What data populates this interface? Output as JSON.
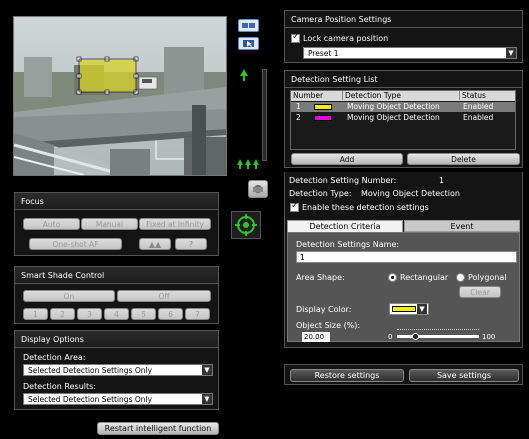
{
  "focus": {
    "title": "Focus",
    "auto": "Auto",
    "manual": "Manual",
    "fixed": "Fixed at Infinity",
    "one_shot": "One-shot AF"
  },
  "smart_shade": {
    "title": "Smart Shade Control",
    "on": "On",
    "off": "Off",
    "levels": [
      "1",
      "2",
      "3",
      "4",
      "5",
      "6",
      "7"
    ]
  },
  "display_options": {
    "title": "Display Options",
    "area_label": "Detection Area:",
    "area_value": "Selected Detection Settings Only",
    "results_label": "Detection Results:",
    "results_value": "Selected Detection Settings Only"
  },
  "restart_label": "Restart intelligent function",
  "camera_position": {
    "title": "Camera Position Settings",
    "lock_label": "Lock camera position",
    "preset": "Preset 1"
  },
  "detection_list": {
    "title": "Detection Setting List",
    "columns": [
      "Number",
      "Detection Type",
      "Status"
    ],
    "rows": [
      {
        "number": "1",
        "color": "#f2ee00",
        "type": "Moving Object Detection",
        "status": "Enabled"
      },
      {
        "number": "2",
        "color": "#e000e0",
        "type": "Moving Object Detection",
        "status": "Enabled"
      }
    ],
    "add": "Add",
    "delete": "Delete"
  },
  "detection_info": {
    "number_label": "Detection Setting Number:",
    "number_value": "1",
    "type_label": "Detection Type:",
    "type_value": "Moving Object Detection",
    "enable_label": "Enable these detection settings"
  },
  "tabs": {
    "criteria": "Detection Criteria",
    "event": "Event"
  },
  "criteria": {
    "name_label": "Detection Settings Name:",
    "name_value": "1",
    "area_shape_label": "Area Shape:",
    "rectangular": "Rectangular",
    "polygonal": "Polygonal",
    "clear": "Clear",
    "display_color_label": "Display Color:",
    "display_color": "#f2ee00",
    "object_size_label": "Object Size (%):",
    "object_size_value": "20.00",
    "slider_min": "0",
    "slider_max": "100",
    "slider_fraction": 0.2
  },
  "bottom": {
    "restore": "Restore settings",
    "save": "Save settings"
  }
}
